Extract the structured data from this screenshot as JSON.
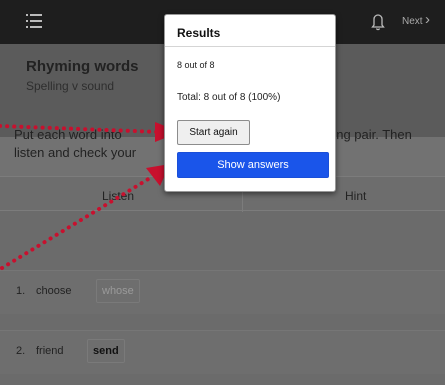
{
  "topbar": {
    "menu_icon": "hamburger-menu-icon",
    "bell_icon": "bell-icon",
    "next_label": "Next",
    "next_chevron": "›"
  },
  "header": {
    "title": "Rhyming words",
    "subtitle": "Spelling v sound"
  },
  "instructions": {
    "line1_left": "Put each word into",
    "line1_right": "yming pair. Then",
    "line2_left": "listen and check your"
  },
  "columns": {
    "listen": "Listen",
    "hint": "Hint"
  },
  "rows": [
    {
      "number": "1.",
      "word": "choose",
      "answer": "whose"
    },
    {
      "number": "2.",
      "word": "friend",
      "answer": "send"
    }
  ],
  "results_popup": {
    "title": "Results",
    "score": "8 out of 8",
    "total": "Total: 8 out of 8 (100%)",
    "start_again_label": "Start again",
    "show_answers_label": "Show answers"
  },
  "colors": {
    "accent_blue": "#1a55ea",
    "annotation_red": "#c8102e"
  }
}
